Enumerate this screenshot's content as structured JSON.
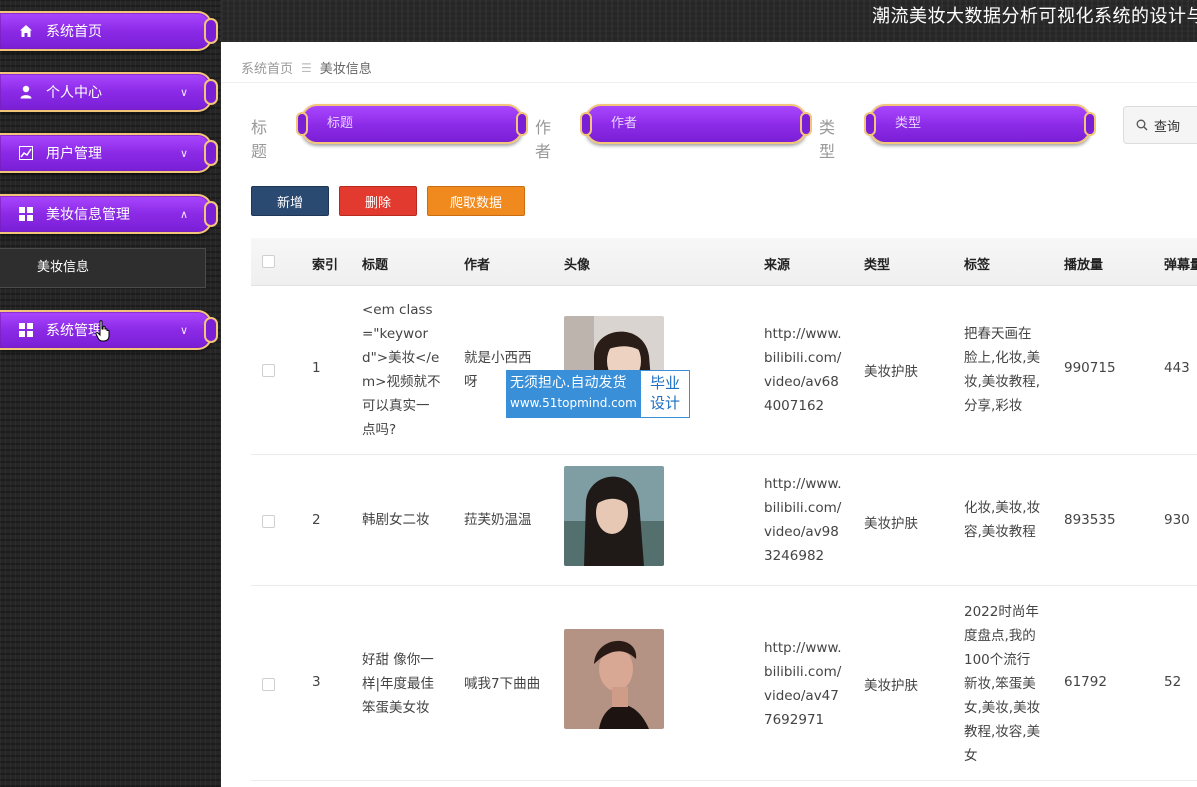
{
  "app_title": "潮流美妆大数据分析可视化系统的设计与",
  "sidebar": {
    "items": [
      {
        "label": "系统首页",
        "icon": "home-icon"
      },
      {
        "label": "个人中心",
        "icon": "user-icon"
      },
      {
        "label": "用户管理",
        "icon": "chart-icon"
      },
      {
        "label": "美妆信息管理",
        "icon": "grid-icon"
      },
      {
        "label": "系统管理",
        "icon": "grid-icon"
      }
    ],
    "submenu_label": "美妆信息"
  },
  "breadcrumb": {
    "home": "系统首页",
    "separator": "☰",
    "current": "美妆信息"
  },
  "search": {
    "title_label": "标题",
    "title_placeholder": "标题",
    "author_label": "作者",
    "author_placeholder": "作者",
    "type_label": "类型",
    "type_placeholder": "类型",
    "query_label": "查询"
  },
  "actions": {
    "add": "新增",
    "delete": "删除",
    "crawl": "爬取数据"
  },
  "table": {
    "headers": [
      "索引",
      "标题",
      "作者",
      "头像",
      "来源",
      "类型",
      "标签",
      "播放量",
      "弹幕量"
    ],
    "rows": [
      {
        "index": "1",
        "title": [
          "<em class",
          "=\"keywor",
          "d\">美妆</e",
          "m>视频就不",
          "可以真实一",
          "点吗?"
        ],
        "author": [
          "就是小西西",
          "呀"
        ],
        "source": [
          "http://www.",
          "bilibili.com/",
          "video/av68",
          "4007162"
        ],
        "type": "美妆护肤",
        "tags": [
          "把春天画在",
          "脸上,化妆,美",
          "妆,美妆教程,",
          "分享,彩妆"
        ],
        "plays": "990715",
        "danmaku": "443"
      },
      {
        "index": "2",
        "title": [
          "韩剧女二妆"
        ],
        "author": [
          "菈芙奶温温"
        ],
        "source": [
          "http://www.",
          "bilibili.com/",
          "video/av98",
          "3246982"
        ],
        "type": "美妆护肤",
        "tags": [
          "化妆,美妆,妆",
          "容,美妆教程"
        ],
        "plays": "893535",
        "danmaku": "930"
      },
      {
        "index": "3",
        "title": [
          "好甜 像你一",
          "样|年度最佳",
          "笨蛋美女妆"
        ],
        "author": [
          "喊我7下曲曲"
        ],
        "source": [
          "http://www.",
          "bilibili.com/",
          "video/av47",
          "7692971"
        ],
        "type": "美妆护肤",
        "tags": [
          "2022时尚年",
          "度盘点,我的",
          "100个流行",
          "新妆,笨蛋美",
          "女,美妆,美妆",
          "教程,妆容,美",
          "女"
        ],
        "plays": "61792",
        "danmaku": "52"
      }
    ]
  },
  "watermark": {
    "line1": "无须担心.自动发货",
    "line2": "www.51topmind.com",
    "right1": "毕业",
    "right2": "设计"
  }
}
